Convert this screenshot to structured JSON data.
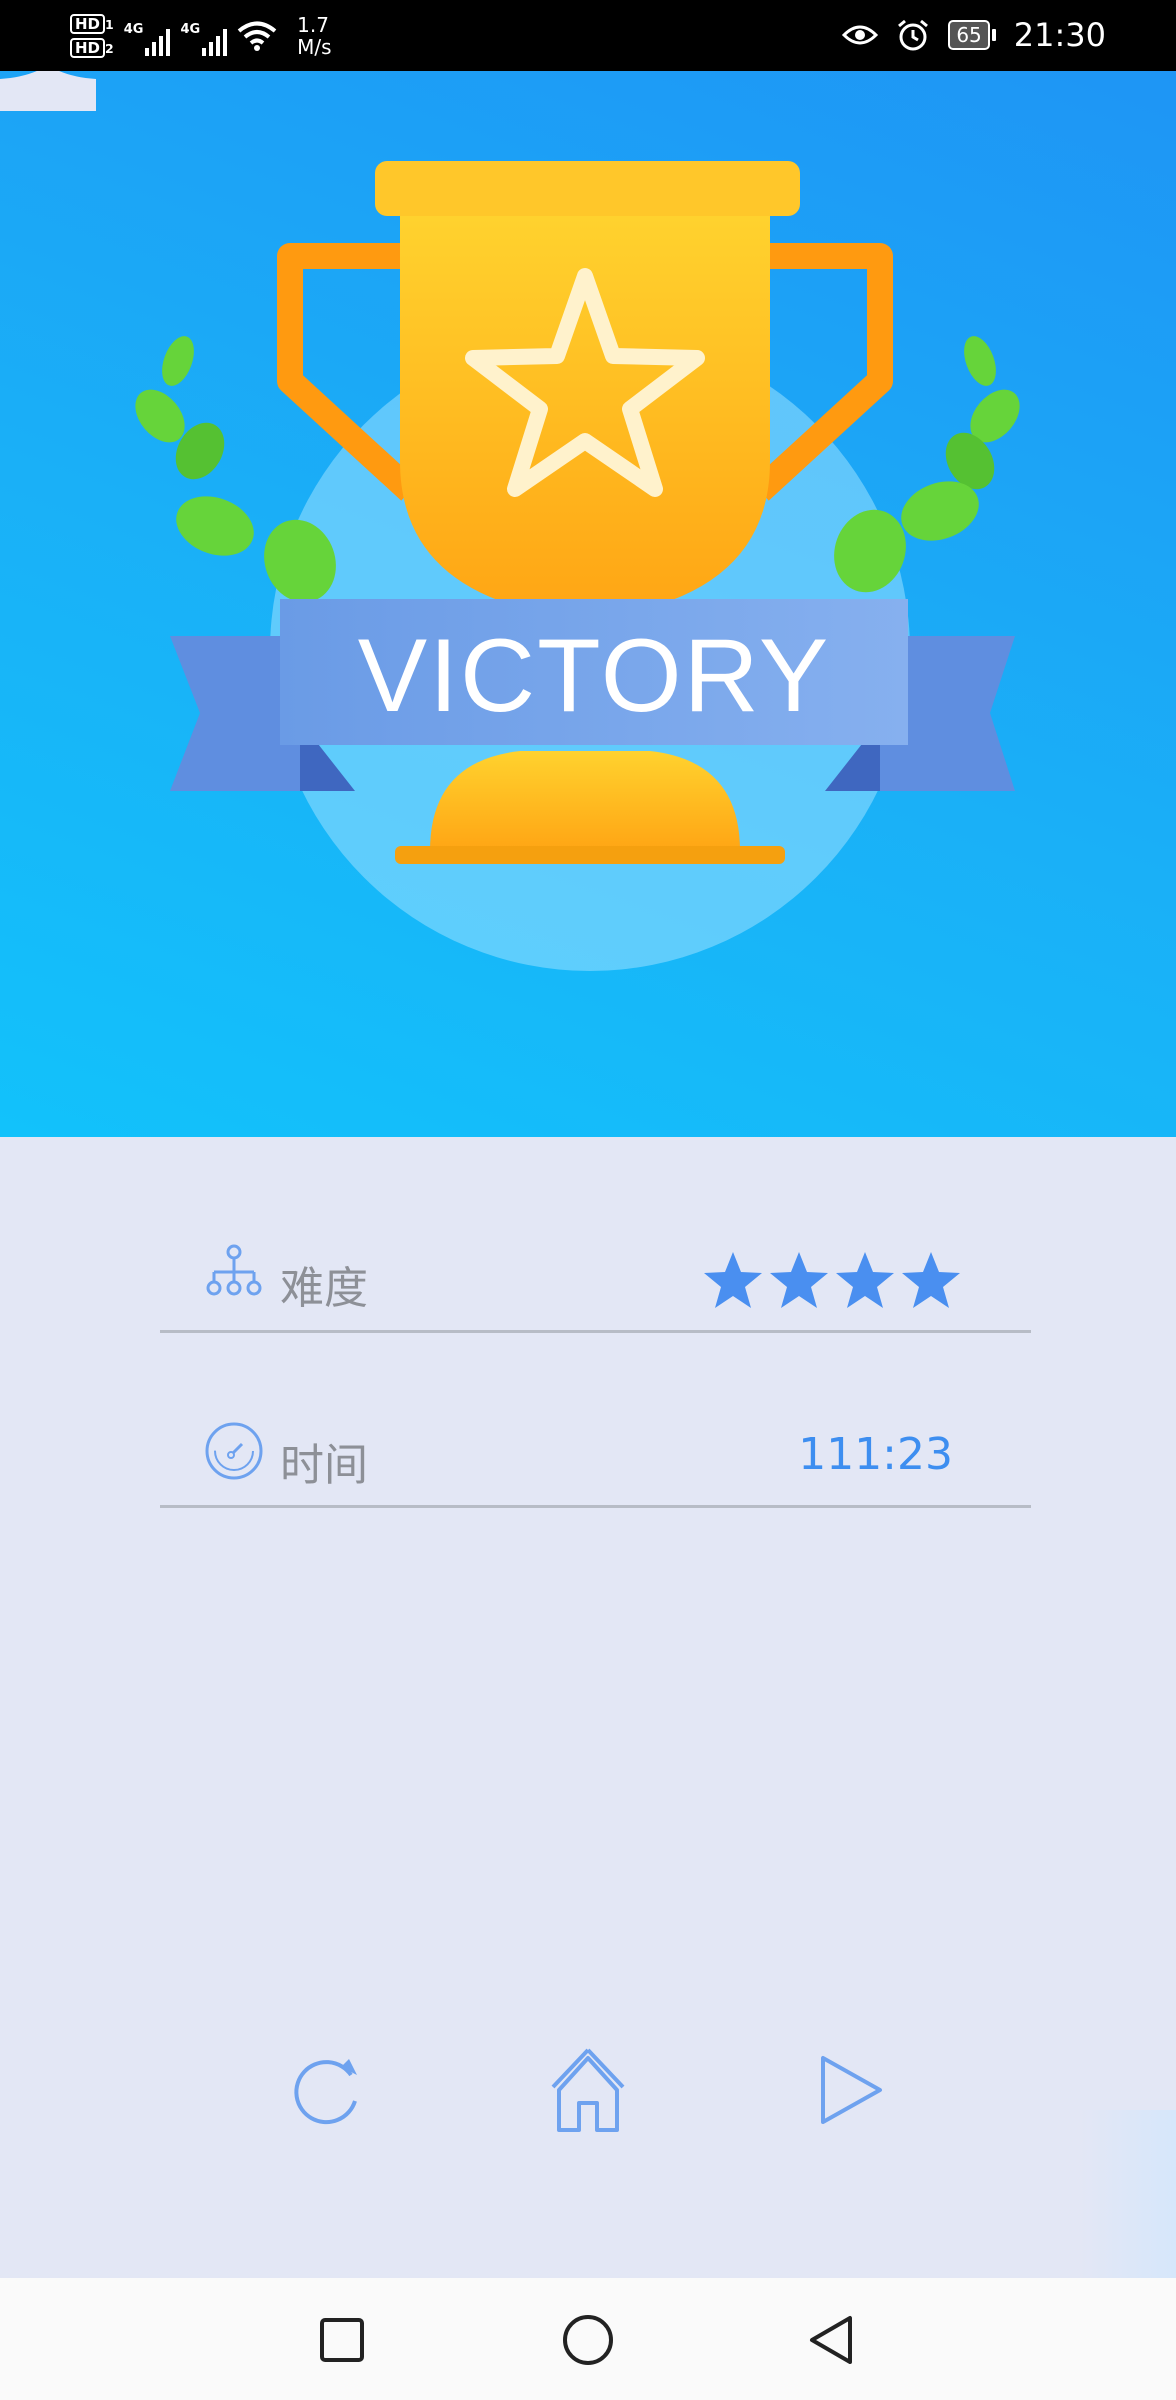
{
  "status_bar": {
    "sim1": "HD",
    "sim1_index": "1",
    "sim2": "HD",
    "sim2_index": "2",
    "network1": "4G",
    "network2": "4G",
    "speed_value": "1.7",
    "speed_unit": "M/s",
    "battery": "65",
    "time": "21:30",
    "icons": [
      "eye-icon",
      "alarm-icon",
      "battery-icon",
      "wifi-icon",
      "signal-icon"
    ]
  },
  "hero": {
    "banner_text": "VICTORY",
    "icons": [
      "trophy-icon",
      "star-icon",
      "laurel-icon"
    ]
  },
  "stats": {
    "difficulty": {
      "label": "难度",
      "stars": 4,
      "icon": "hierarchy-icon"
    },
    "time": {
      "label": "时间",
      "value": "111:23",
      "icon": "stopwatch-icon"
    }
  },
  "actions": {
    "icons": [
      "refresh-icon",
      "home-icon",
      "play-icon"
    ]
  },
  "nav_bar": {
    "icons": [
      "square-recents-icon",
      "circle-home-icon",
      "triangle-back-icon"
    ]
  },
  "colors": {
    "accent": "#4a8ff0",
    "hero_top": "#1e95f5",
    "hero_bottom": "#12c2fb",
    "trophy": "#ffae1c",
    "ribbon": "#6f9ee6",
    "laurel": "#66d43a",
    "background": "#e3e7f5"
  }
}
